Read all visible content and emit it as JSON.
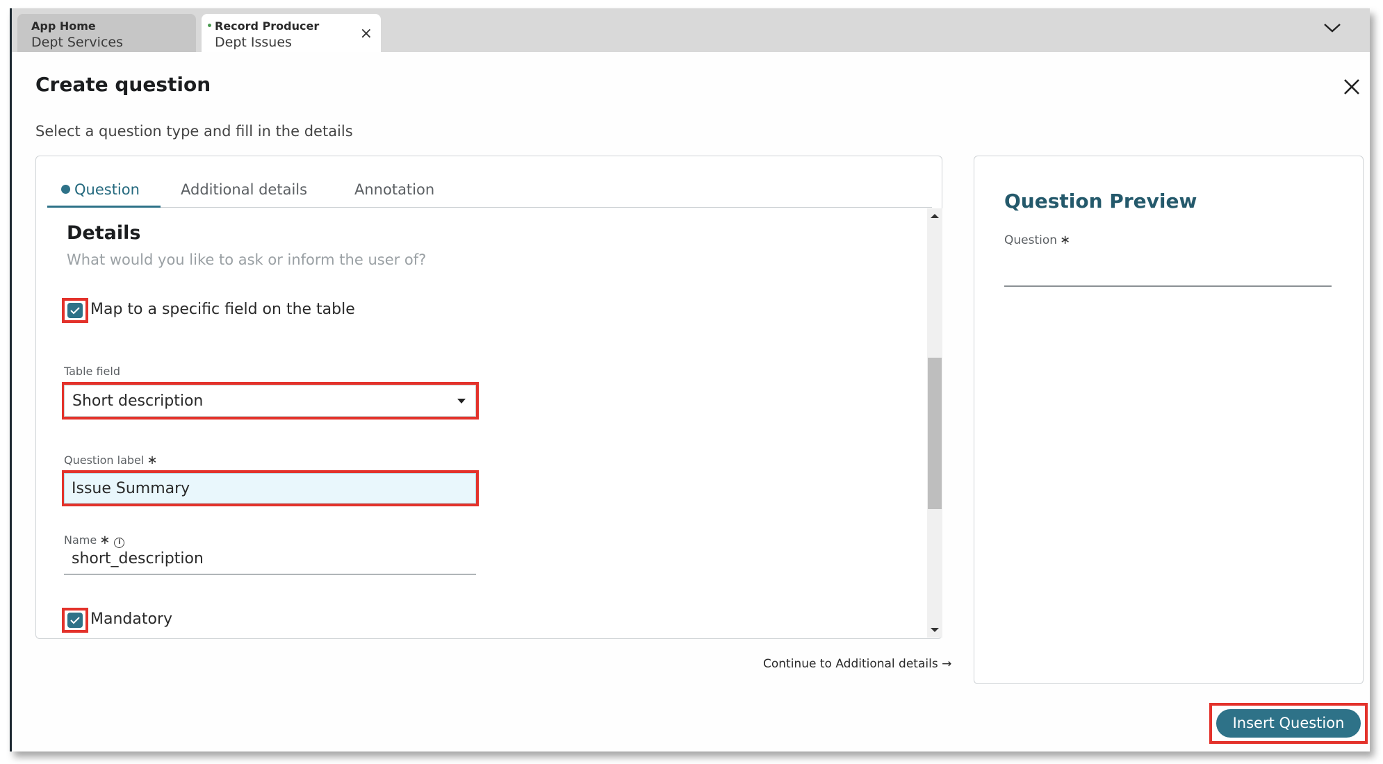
{
  "tabs": [
    {
      "title": "App Home",
      "subtitle": "Dept Services",
      "active": false
    },
    {
      "title": "Record Producer",
      "subtitle": "Dept Issues",
      "active": true,
      "close_icon": "close-icon",
      "modified_indicator": true
    }
  ],
  "tabbar": {
    "overflow_icon": "chevron-down-icon"
  },
  "dialog": {
    "title": "Create question",
    "subtitle": "Select a question type and fill in the details",
    "close_icon": "close-icon"
  },
  "question_tabs": [
    {
      "label": "Question",
      "active": true
    },
    {
      "label": "Additional details",
      "active": false
    },
    {
      "label": "Annotation",
      "active": false
    }
  ],
  "details": {
    "title": "Details",
    "prompt": "What would you like to ask or inform the user of?",
    "map_checkbox": {
      "label": "Map to a specific field on the table",
      "checked": true
    },
    "table_field": {
      "label": "Table field",
      "value": "Short description"
    },
    "question_label": {
      "label": "Question label",
      "required_mark": "∗",
      "value": "Issue Summary"
    },
    "name": {
      "label": "Name",
      "required_mark": "∗",
      "info_icon": "i",
      "value": "short_description"
    },
    "mandatory_checkbox": {
      "label": "Mandatory",
      "checked": true
    }
  },
  "continue_link": "Continue to Additional details →",
  "preview": {
    "title": "Question Preview",
    "question_label": "Question",
    "required_mark": "∗",
    "value": ""
  },
  "insert_button": "Insert Question",
  "colors": {
    "accent": "#2e7288",
    "highlight": "#e3322b",
    "preview_title": "#24596b",
    "input_focus_bg": "#e9f7fc"
  }
}
